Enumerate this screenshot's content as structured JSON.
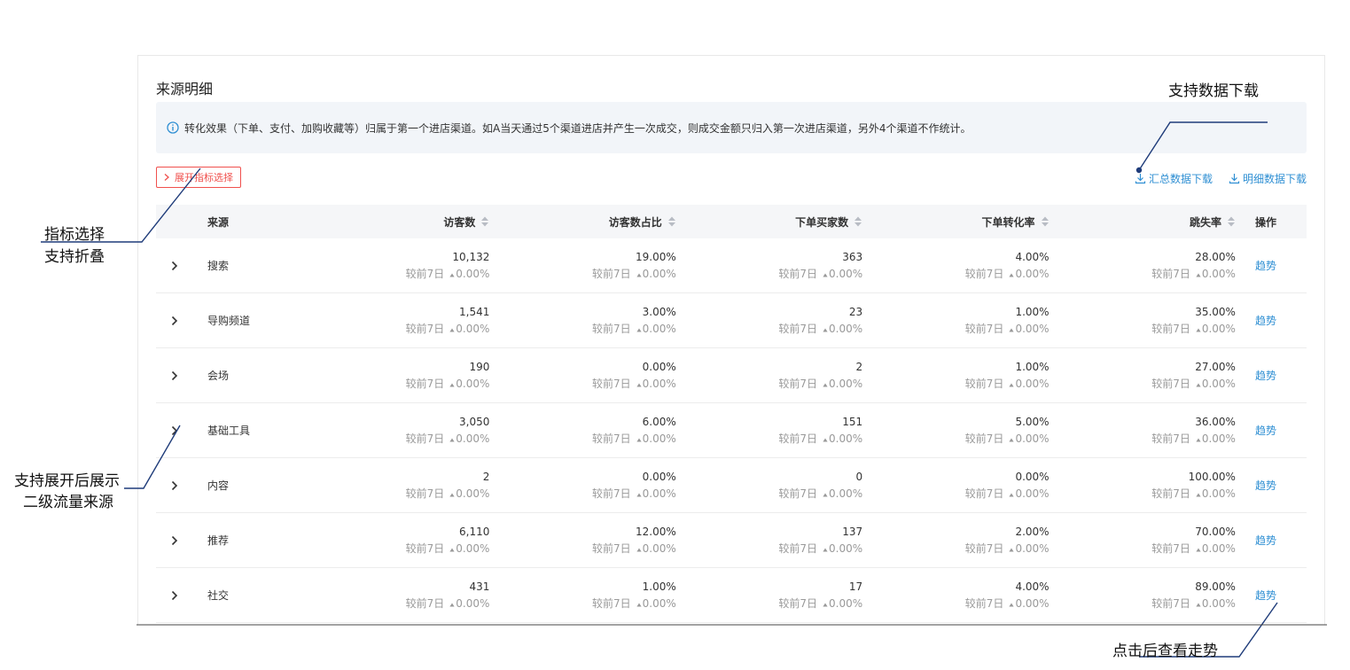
{
  "card": {
    "title": "来源明细",
    "notice": "转化效果（下单、支付、加购收藏等）归属于第一个进店渠道。如A当天通过5个渠道进店并产生一次成交，则成交金额只归入第一次进店渠道，另外4个渠道不作统计。",
    "expand_button": "展开指标选择",
    "download_summary": "汇总数据下载",
    "download_detail": "明细数据下载"
  },
  "table": {
    "headers": {
      "source": "来源",
      "visitors": "访客数",
      "visitor_share": "访客数占比",
      "buyers": "下单买家数",
      "conversion": "下单转化率",
      "bounce": "跳失率",
      "action": "操作"
    },
    "compare_label": "较前7日",
    "compare_value": "0.00%",
    "action_label": "趋势",
    "rows": [
      {
        "source": "搜索",
        "visitors": "10,132",
        "visitor_share": "19.00%",
        "buyers": "363",
        "conversion": "4.00%",
        "bounce": "28.00%"
      },
      {
        "source": "导购频道",
        "visitors": "1,541",
        "visitor_share": "3.00%",
        "buyers": "23",
        "conversion": "1.00%",
        "bounce": "35.00%"
      },
      {
        "source": "会场",
        "visitors": "190",
        "visitor_share": "0.00%",
        "buyers": "2",
        "conversion": "1.00%",
        "bounce": "27.00%"
      },
      {
        "source": "基础工具",
        "visitors": "3,050",
        "visitor_share": "6.00%",
        "buyers": "151",
        "conversion": "5.00%",
        "bounce": "36.00%"
      },
      {
        "source": "内容",
        "visitors": "2",
        "visitor_share": "0.00%",
        "buyers": "0",
        "conversion": "0.00%",
        "bounce": "100.00%"
      },
      {
        "source": "推荐",
        "visitors": "6,110",
        "visitor_share": "12.00%",
        "buyers": "137",
        "conversion": "2.00%",
        "bounce": "70.00%"
      },
      {
        "source": "社交",
        "visitors": "431",
        "visitor_share": "1.00%",
        "buyers": "17",
        "conversion": "4.00%",
        "bounce": "89.00%"
      }
    ]
  },
  "annotations": {
    "download": "支持数据下载",
    "metric_line1": "指标选择",
    "metric_line2": "支持折叠",
    "expand_line1": "支持展开后展示",
    "expand_line2": "二级流量来源",
    "trend": "点击后查看走势"
  },
  "colors": {
    "accent_red": "#f0504d",
    "link_blue": "#2f8fd3",
    "annotation_line": "#1f3c7a"
  }
}
